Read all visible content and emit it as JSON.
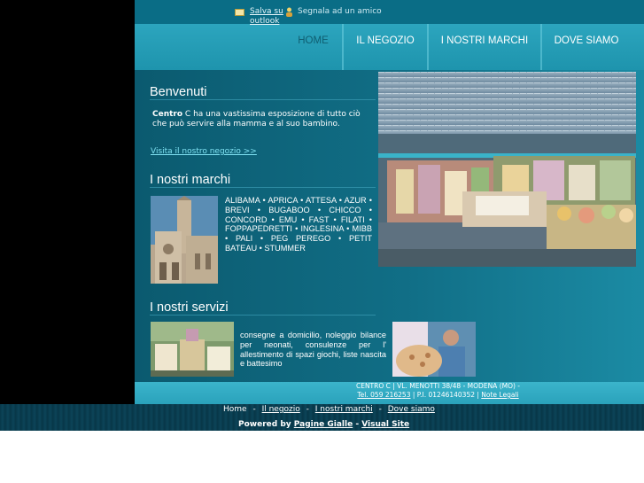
{
  "top_bar": {
    "save_outlook": "Salva su outlook",
    "tell_friend": "Segnala ad un amico"
  },
  "nav": {
    "items": [
      "HOME",
      "IL NEGOZIO",
      "I NOSTRI MARCHI",
      "DOVE SIAMO"
    ],
    "active": "HOME"
  },
  "welcome": {
    "title": "Benvenuti",
    "brand": "Centro",
    "text": "C ha una vastissima esposizione di tutto ciò che può servire alla mamma e al suo bambino.",
    "link": "Visita il nostro negozio >>"
  },
  "brands": {
    "title": "I nostri marchi",
    "list": "ALIBAMA • APRICA • ATTESA • AZUR • BREVI • BUGABOO • CHICCO • CONCORD • EMU • FAST • FILATI • FOPPAPEDRETTI • INGLESINA • MIBB • PALI • PEG PEREGO • PETIT BATEAU • STUMMER"
  },
  "services": {
    "title": "I nostri servizi",
    "text": "consegne a domicilio, noleggio bilance per neonati, consulenze per l' allestimento di spazi giochi, liste nascita e battesimo"
  },
  "address": {
    "line1": "CENTRO C | VL. MENOTTI 38/48 - MODENA (MO) -",
    "phone": "Tel. 059 216253",
    "vat": "| P.I. 01246140352 |",
    "legal": "Note Legali"
  },
  "footer": {
    "links": [
      "Home",
      "Il negozio",
      "I nostri marchi",
      "Dove siamo"
    ],
    "powered_by": "Powered by",
    "pagine": "Pagine Gialle",
    "visual": "Visual Site"
  },
  "colors": {
    "accent": "#2ca5be",
    "content_bg": "#0b5a6f",
    "link": "#7fe1f2"
  }
}
